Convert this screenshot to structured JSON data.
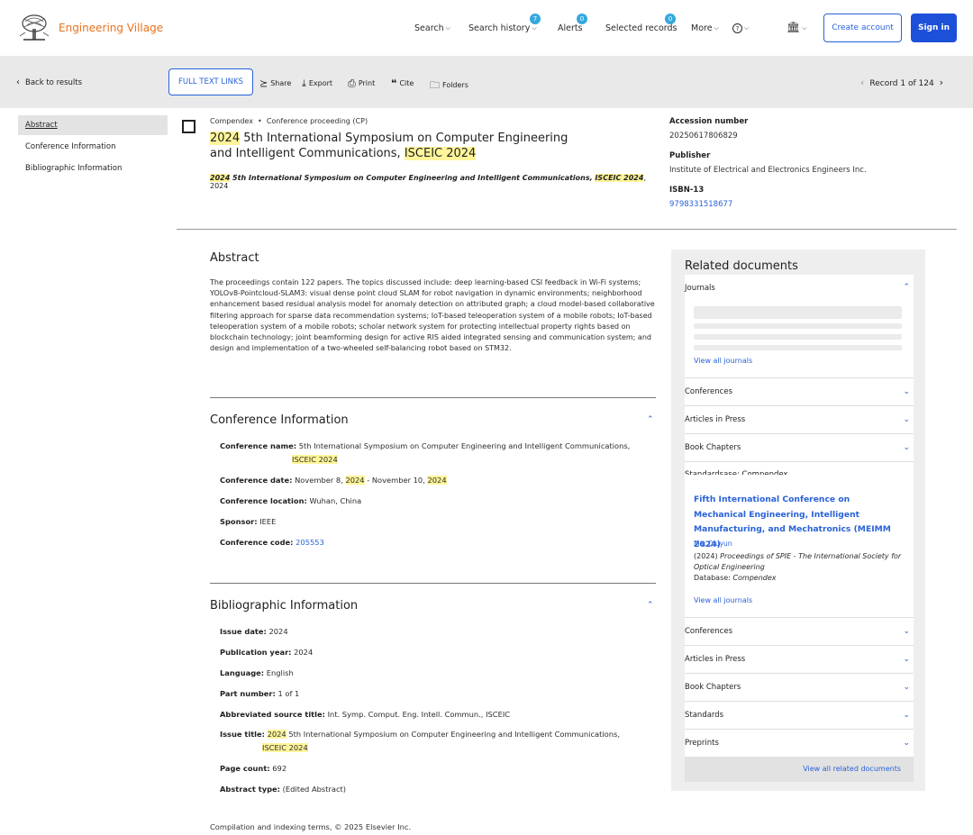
{
  "header": {
    "brand": "Engineering Village",
    "nav": {
      "search": "Search",
      "search_history": "Search history",
      "search_history_count": "7",
      "alerts": "Alerts",
      "alerts_count": "0",
      "selected_records": "Selected records",
      "selected_records_count": "0",
      "more": "More",
      "help": "?"
    },
    "create_account": "Create account",
    "sign_in": "Sign in"
  },
  "toolbar": {
    "back": "Back to results",
    "full_text_links": "FULL TEXT LINKS",
    "share": "Share",
    "export": "Export",
    "print": "Print",
    "cite": "Cite",
    "folders": "Folders",
    "record": "Record 1 of 124"
  },
  "sidebar": {
    "items": [
      "Abstract",
      "Conference Information",
      "Bibliographic Information"
    ]
  },
  "record": {
    "database": "Compendex",
    "doc_type": "Conference proceeding (CP)",
    "title_year": "2024",
    "title_mid": " 5th International Symposium on Computer Engineering and Intelligent Communications, ",
    "title_acronym": "ISCEIC 2024",
    "source_year": "2024",
    "source_mid": " 5th International Symposium on Computer Engineering and Intelligent Communications, ",
    "source_acronym": "ISCEIC 2024",
    "source_tail": ", 2024",
    "accession_label": "Accession number",
    "accession_value": "20250617806829",
    "publisher_label": "Publisher",
    "publisher_value": "Institute of Electrical and Electronics Engineers Inc.",
    "isbn_label": "ISBN-13",
    "isbn_value": "9798331518677"
  },
  "abstract": {
    "heading": "Abstract",
    "text": "The proceedings contain 122 papers. The topics discussed include: deep learning-based CSI feedback in Wi-Fi systems; YOLOv8-Pointcloud-SLAM3: visual dense point cloud SLAM for robot navigation in dynamic environments; neighborhood enhancement based residual analysis model for anomaly detection on attributed graph; a cloud model-based collaborative filtering approach for sparse data recommendation systems; IoT-based teleoperation system of a mobile robots; IoT-based teleoperation system of a mobile robots; scholar network system for protecting intellectual property rights based on blockchain technology; joint beamforming design for active RIS aided integrated sensing and communication system; and design and implementation of a two-wheeled self-balancing robot based on STM32."
  },
  "conference": {
    "heading": "Conference Information",
    "name_label": "Conference name:",
    "name_value": "5th International Symposium on Computer Engineering and Intelligent Communications,",
    "name_hl": "ISCEIC 2024",
    "date_label": "Conference date:",
    "date_a": "November 8, ",
    "date_y1": "2024",
    "date_b": " - November 10, ",
    "date_y2": "2024",
    "location_label": "Conference location:",
    "location_value": "Wuhan, China",
    "sponsor_label": "Sponsor:",
    "sponsor_value": "IEEE",
    "code_label": "Conference code:",
    "code_value": "205553"
  },
  "bibliographic": {
    "heading": "Bibliographic Information",
    "issue_date_label": "Issue date:",
    "issue_date_value": "2024",
    "pub_year_label": "Publication year:",
    "pub_year_value": "2024",
    "language_label": "Language:",
    "language_value": "English",
    "part_label": "Part number:",
    "part_value": "1 of 1",
    "abbr_label": "Abbreviated source title:",
    "abbr_value": "Int. Symp. Comput. Eng. Intell. Commun., ISCEIC",
    "issue_title_label": "Issue title:",
    "issue_title_year": "2024",
    "issue_title_mid": " 5th International Symposium on Computer Engineering and Intelligent Communications,",
    "issue_title_hl": "ISCEIC 2024",
    "page_count_label": "Page count:",
    "page_count_value": "692",
    "abstract_type_label": "Abstract type:",
    "abstract_type_value": "(Edited Abstract)"
  },
  "related": {
    "heading": "Related documents",
    "journals": "Journals",
    "view_all_journals": "View all journals",
    "conferences": "Conferences",
    "articles_in_press": "Articles in Press",
    "book_chapters": "Book Chapters",
    "standards_overlap": "Standardsase: Compendex",
    "featured_title": "Fifth International Conference on Mechanical Engineering, Intelligent Manufacturing, and Mechatronics (MEIMM 2024)",
    "featured_author": "Ma, Qiuyun",
    "featured_year": "(2024) ",
    "featured_source": "Proceedings of SPIE - The International Society for Optical Engineering",
    "featured_db_label": "Database: ",
    "featured_db": "Compendex",
    "view_all_journals_2": "View all journals",
    "conferences_2": "Conferences",
    "articles_in_press_2": "Articles in Press",
    "book_chapters_2": "Book Chapters",
    "standards": "Standards",
    "preprints": "Preprints",
    "view_all_related": "View all related documents"
  },
  "footer": {
    "copyright": "Compilation and indexing terms, © 2025 Elsevier Inc."
  },
  "colors": {
    "brand": "#e9711c",
    "link": "#2962d9",
    "highlight": "#fff59a",
    "badge": "#35a8de",
    "primary_button": "#1d50d8"
  }
}
